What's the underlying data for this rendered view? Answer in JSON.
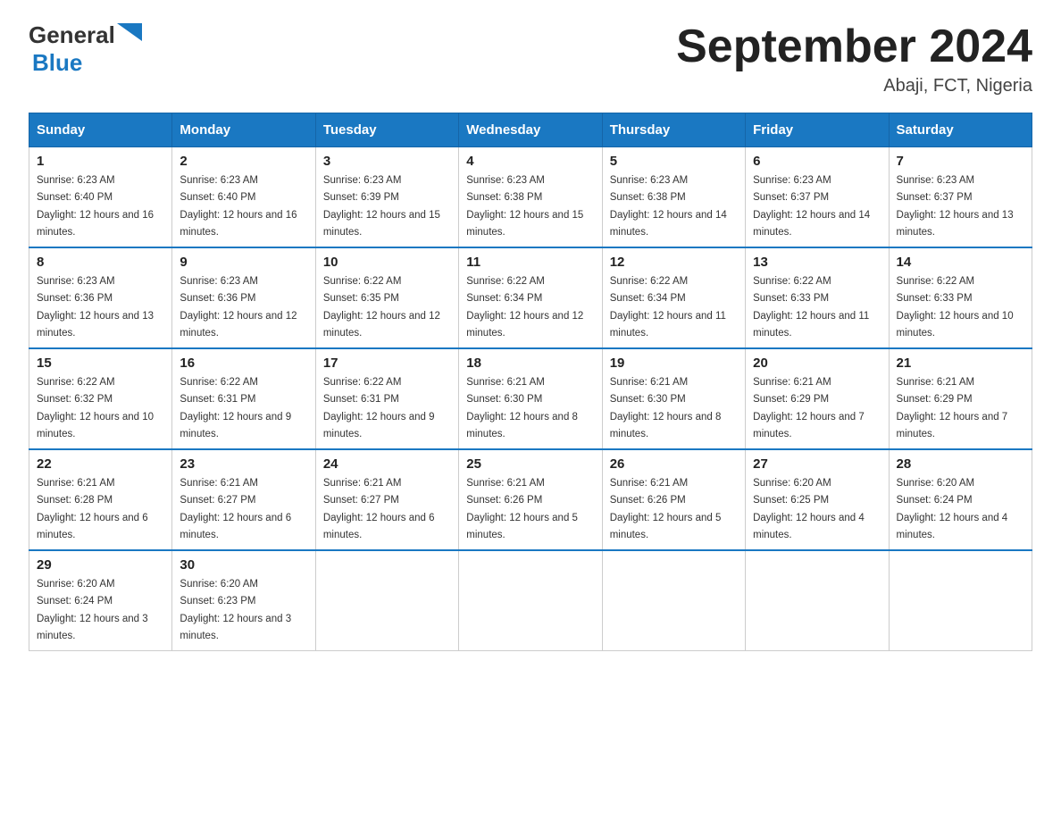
{
  "header": {
    "logo": {
      "general": "General",
      "blue": "Blue",
      "triangle_color": "#1a78c2"
    },
    "title": "September 2024",
    "subtitle": "Abaji, FCT, Nigeria"
  },
  "calendar": {
    "headers": [
      "Sunday",
      "Monday",
      "Tuesday",
      "Wednesday",
      "Thursday",
      "Friday",
      "Saturday"
    ],
    "weeks": [
      [
        {
          "day": "1",
          "sunrise": "Sunrise: 6:23 AM",
          "sunset": "Sunset: 6:40 PM",
          "daylight": "Daylight: 12 hours and 16 minutes."
        },
        {
          "day": "2",
          "sunrise": "Sunrise: 6:23 AM",
          "sunset": "Sunset: 6:40 PM",
          "daylight": "Daylight: 12 hours and 16 minutes."
        },
        {
          "day": "3",
          "sunrise": "Sunrise: 6:23 AM",
          "sunset": "Sunset: 6:39 PM",
          "daylight": "Daylight: 12 hours and 15 minutes."
        },
        {
          "day": "4",
          "sunrise": "Sunrise: 6:23 AM",
          "sunset": "Sunset: 6:38 PM",
          "daylight": "Daylight: 12 hours and 15 minutes."
        },
        {
          "day": "5",
          "sunrise": "Sunrise: 6:23 AM",
          "sunset": "Sunset: 6:38 PM",
          "daylight": "Daylight: 12 hours and 14 minutes."
        },
        {
          "day": "6",
          "sunrise": "Sunrise: 6:23 AM",
          "sunset": "Sunset: 6:37 PM",
          "daylight": "Daylight: 12 hours and 14 minutes."
        },
        {
          "day": "7",
          "sunrise": "Sunrise: 6:23 AM",
          "sunset": "Sunset: 6:37 PM",
          "daylight": "Daylight: 12 hours and 13 minutes."
        }
      ],
      [
        {
          "day": "8",
          "sunrise": "Sunrise: 6:23 AM",
          "sunset": "Sunset: 6:36 PM",
          "daylight": "Daylight: 12 hours and 13 minutes."
        },
        {
          "day": "9",
          "sunrise": "Sunrise: 6:23 AM",
          "sunset": "Sunset: 6:36 PM",
          "daylight": "Daylight: 12 hours and 12 minutes."
        },
        {
          "day": "10",
          "sunrise": "Sunrise: 6:22 AM",
          "sunset": "Sunset: 6:35 PM",
          "daylight": "Daylight: 12 hours and 12 minutes."
        },
        {
          "day": "11",
          "sunrise": "Sunrise: 6:22 AM",
          "sunset": "Sunset: 6:34 PM",
          "daylight": "Daylight: 12 hours and 12 minutes."
        },
        {
          "day": "12",
          "sunrise": "Sunrise: 6:22 AM",
          "sunset": "Sunset: 6:34 PM",
          "daylight": "Daylight: 12 hours and 11 minutes."
        },
        {
          "day": "13",
          "sunrise": "Sunrise: 6:22 AM",
          "sunset": "Sunset: 6:33 PM",
          "daylight": "Daylight: 12 hours and 11 minutes."
        },
        {
          "day": "14",
          "sunrise": "Sunrise: 6:22 AM",
          "sunset": "Sunset: 6:33 PM",
          "daylight": "Daylight: 12 hours and 10 minutes."
        }
      ],
      [
        {
          "day": "15",
          "sunrise": "Sunrise: 6:22 AM",
          "sunset": "Sunset: 6:32 PM",
          "daylight": "Daylight: 12 hours and 10 minutes."
        },
        {
          "day": "16",
          "sunrise": "Sunrise: 6:22 AM",
          "sunset": "Sunset: 6:31 PM",
          "daylight": "Daylight: 12 hours and 9 minutes."
        },
        {
          "day": "17",
          "sunrise": "Sunrise: 6:22 AM",
          "sunset": "Sunset: 6:31 PM",
          "daylight": "Daylight: 12 hours and 9 minutes."
        },
        {
          "day": "18",
          "sunrise": "Sunrise: 6:21 AM",
          "sunset": "Sunset: 6:30 PM",
          "daylight": "Daylight: 12 hours and 8 minutes."
        },
        {
          "day": "19",
          "sunrise": "Sunrise: 6:21 AM",
          "sunset": "Sunset: 6:30 PM",
          "daylight": "Daylight: 12 hours and 8 minutes."
        },
        {
          "day": "20",
          "sunrise": "Sunrise: 6:21 AM",
          "sunset": "Sunset: 6:29 PM",
          "daylight": "Daylight: 12 hours and 7 minutes."
        },
        {
          "day": "21",
          "sunrise": "Sunrise: 6:21 AM",
          "sunset": "Sunset: 6:29 PM",
          "daylight": "Daylight: 12 hours and 7 minutes."
        }
      ],
      [
        {
          "day": "22",
          "sunrise": "Sunrise: 6:21 AM",
          "sunset": "Sunset: 6:28 PM",
          "daylight": "Daylight: 12 hours and 6 minutes."
        },
        {
          "day": "23",
          "sunrise": "Sunrise: 6:21 AM",
          "sunset": "Sunset: 6:27 PM",
          "daylight": "Daylight: 12 hours and 6 minutes."
        },
        {
          "day": "24",
          "sunrise": "Sunrise: 6:21 AM",
          "sunset": "Sunset: 6:27 PM",
          "daylight": "Daylight: 12 hours and 6 minutes."
        },
        {
          "day": "25",
          "sunrise": "Sunrise: 6:21 AM",
          "sunset": "Sunset: 6:26 PM",
          "daylight": "Daylight: 12 hours and 5 minutes."
        },
        {
          "day": "26",
          "sunrise": "Sunrise: 6:21 AM",
          "sunset": "Sunset: 6:26 PM",
          "daylight": "Daylight: 12 hours and 5 minutes."
        },
        {
          "day": "27",
          "sunrise": "Sunrise: 6:20 AM",
          "sunset": "Sunset: 6:25 PM",
          "daylight": "Daylight: 12 hours and 4 minutes."
        },
        {
          "day": "28",
          "sunrise": "Sunrise: 6:20 AM",
          "sunset": "Sunset: 6:24 PM",
          "daylight": "Daylight: 12 hours and 4 minutes."
        }
      ],
      [
        {
          "day": "29",
          "sunrise": "Sunrise: 6:20 AM",
          "sunset": "Sunset: 6:24 PM",
          "daylight": "Daylight: 12 hours and 3 minutes."
        },
        {
          "day": "30",
          "sunrise": "Sunrise: 6:20 AM",
          "sunset": "Sunset: 6:23 PM",
          "daylight": "Daylight: 12 hours and 3 minutes."
        },
        null,
        null,
        null,
        null,
        null
      ]
    ]
  }
}
